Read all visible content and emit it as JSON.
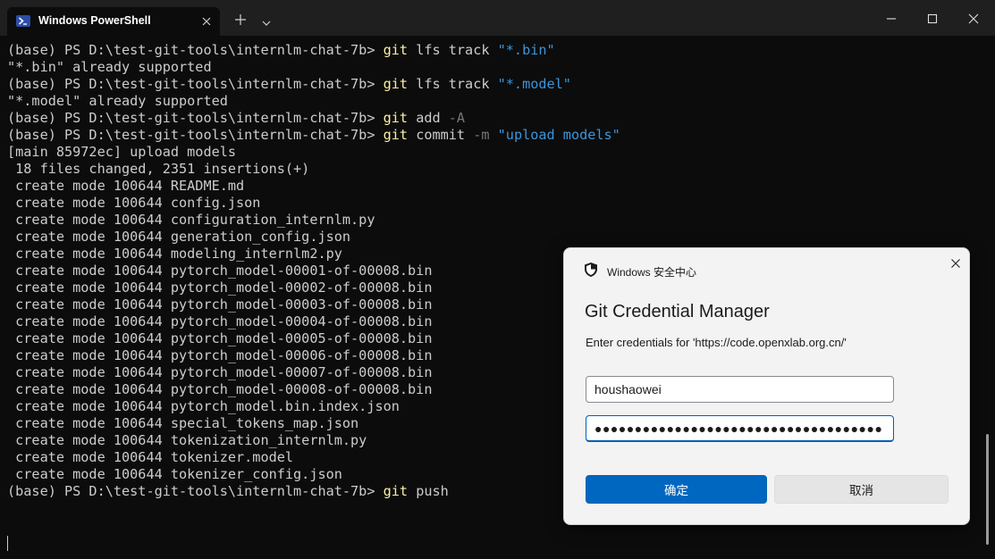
{
  "window": {
    "tab_title": "Windows PowerShell",
    "tab_icon": "powershell-icon",
    "controls": [
      "new-tab-icon",
      "dropdown-chevron-icon",
      "minimize-icon",
      "maximize-icon",
      "close-icon"
    ]
  },
  "terminal": {
    "prompt": "(base) PS D:\\test-git-tools\\internlm-chat-7b> ",
    "colors": {
      "text": "#cccccc",
      "command": "#f9f1a5",
      "string": "#3a96dd",
      "flag": "#767676",
      "background": "#0c0c0c"
    },
    "lines": [
      {
        "type": "cmd",
        "cmd": "git",
        "rest": " lfs track ",
        "str": "\"*.bin\""
      },
      {
        "type": "out",
        "text": "\"*.bin\" already supported"
      },
      {
        "type": "cmd",
        "cmd": "git",
        "rest": " lfs track ",
        "str": "\"*.model\""
      },
      {
        "type": "out",
        "text": "\"*.model\" already supported"
      },
      {
        "type": "cmd",
        "cmd": "git",
        "rest": " add ",
        "flag": "-A"
      },
      {
        "type": "cmd",
        "cmd": "git",
        "rest": " commit ",
        "flag": "-m",
        "rest2": " ",
        "str": "\"upload models\""
      },
      {
        "type": "out",
        "text": "[main 85972ec] upload models"
      },
      {
        "type": "out",
        "text": " 18 files changed, 2351 insertions(+)"
      },
      {
        "type": "out",
        "text": " create mode 100644 README.md"
      },
      {
        "type": "out",
        "text": " create mode 100644 config.json"
      },
      {
        "type": "out",
        "text": " create mode 100644 configuration_internlm.py"
      },
      {
        "type": "out",
        "text": " create mode 100644 generation_config.json"
      },
      {
        "type": "out",
        "text": " create mode 100644 modeling_internlm2.py"
      },
      {
        "type": "out",
        "text": " create mode 100644 pytorch_model-00001-of-00008.bin"
      },
      {
        "type": "out",
        "text": " create mode 100644 pytorch_model-00002-of-00008.bin"
      },
      {
        "type": "out",
        "text": " create mode 100644 pytorch_model-00003-of-00008.bin"
      },
      {
        "type": "out",
        "text": " create mode 100644 pytorch_model-00004-of-00008.bin"
      },
      {
        "type": "out",
        "text": " create mode 100644 pytorch_model-00005-of-00008.bin"
      },
      {
        "type": "out",
        "text": " create mode 100644 pytorch_model-00006-of-00008.bin"
      },
      {
        "type": "out",
        "text": " create mode 100644 pytorch_model-00007-of-00008.bin"
      },
      {
        "type": "out",
        "text": " create mode 100644 pytorch_model-00008-of-00008.bin"
      },
      {
        "type": "out",
        "text": " create mode 100644 pytorch_model.bin.index.json"
      },
      {
        "type": "out",
        "text": " create mode 100644 special_tokens_map.json"
      },
      {
        "type": "out",
        "text": " create mode 100644 tokenization_internlm.py"
      },
      {
        "type": "out",
        "text": " create mode 100644 tokenizer.model"
      },
      {
        "type": "out",
        "text": " create mode 100644 tokenizer_config.json"
      },
      {
        "type": "cmd",
        "cmd": "git",
        "rest": " push"
      }
    ]
  },
  "dialog": {
    "caption": "Windows 安全中心",
    "caption_icon": "shield-icon",
    "title": "Git Credential Manager",
    "message": "Enter credentials for 'https://code.openxlab.org.cn/'",
    "username": "houshaowei",
    "password_mask": "●●●●●●●●●●●●●●●●●●●●●●●●●●●●●●●●●●●●",
    "ok_label": "确定",
    "cancel_label": "取消",
    "accent": "#0067c0"
  }
}
